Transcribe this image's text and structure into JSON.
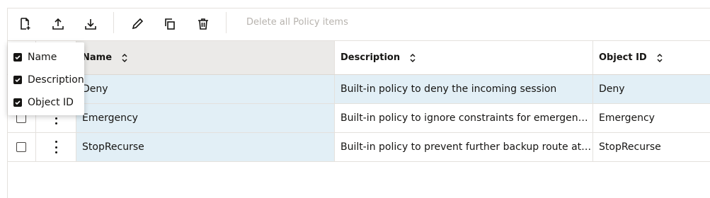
{
  "toolbar": {
    "buttons": [
      {
        "icon": "new-document-icon"
      },
      {
        "icon": "upload-icon"
      },
      {
        "icon": "download-icon"
      },
      {
        "icon": "edit-pencil-icon"
      },
      {
        "icon": "duplicate-icon"
      },
      {
        "icon": "delete-trash-icon"
      }
    ],
    "delete_all_label": "Delete all Policy items"
  },
  "table": {
    "columns": {
      "name": "Name",
      "description": "Description",
      "object_id": "Object ID"
    },
    "rows": [
      {
        "name": "Deny",
        "description": "Built-in policy to deny the incoming session",
        "object_id": "Deny"
      },
      {
        "name": "Emergency",
        "description": "Built-in policy to ignore constraints for emergency ...",
        "object_id": "Emergency"
      },
      {
        "name": "StopRecurse",
        "description": "Built-in policy to prevent further backup route atte...",
        "object_id": "StopRecurse"
      }
    ]
  },
  "column_picker": {
    "items": [
      {
        "label": "Name",
        "checked": true
      },
      {
        "label": "Description",
        "checked": true
      },
      {
        "label": "Object ID",
        "checked": true
      }
    ]
  },
  "colors": {
    "selected_column_bg": "#e2eff6",
    "header_bg_name": "#ebeae8",
    "disabled_text": "#b7b3ae"
  }
}
